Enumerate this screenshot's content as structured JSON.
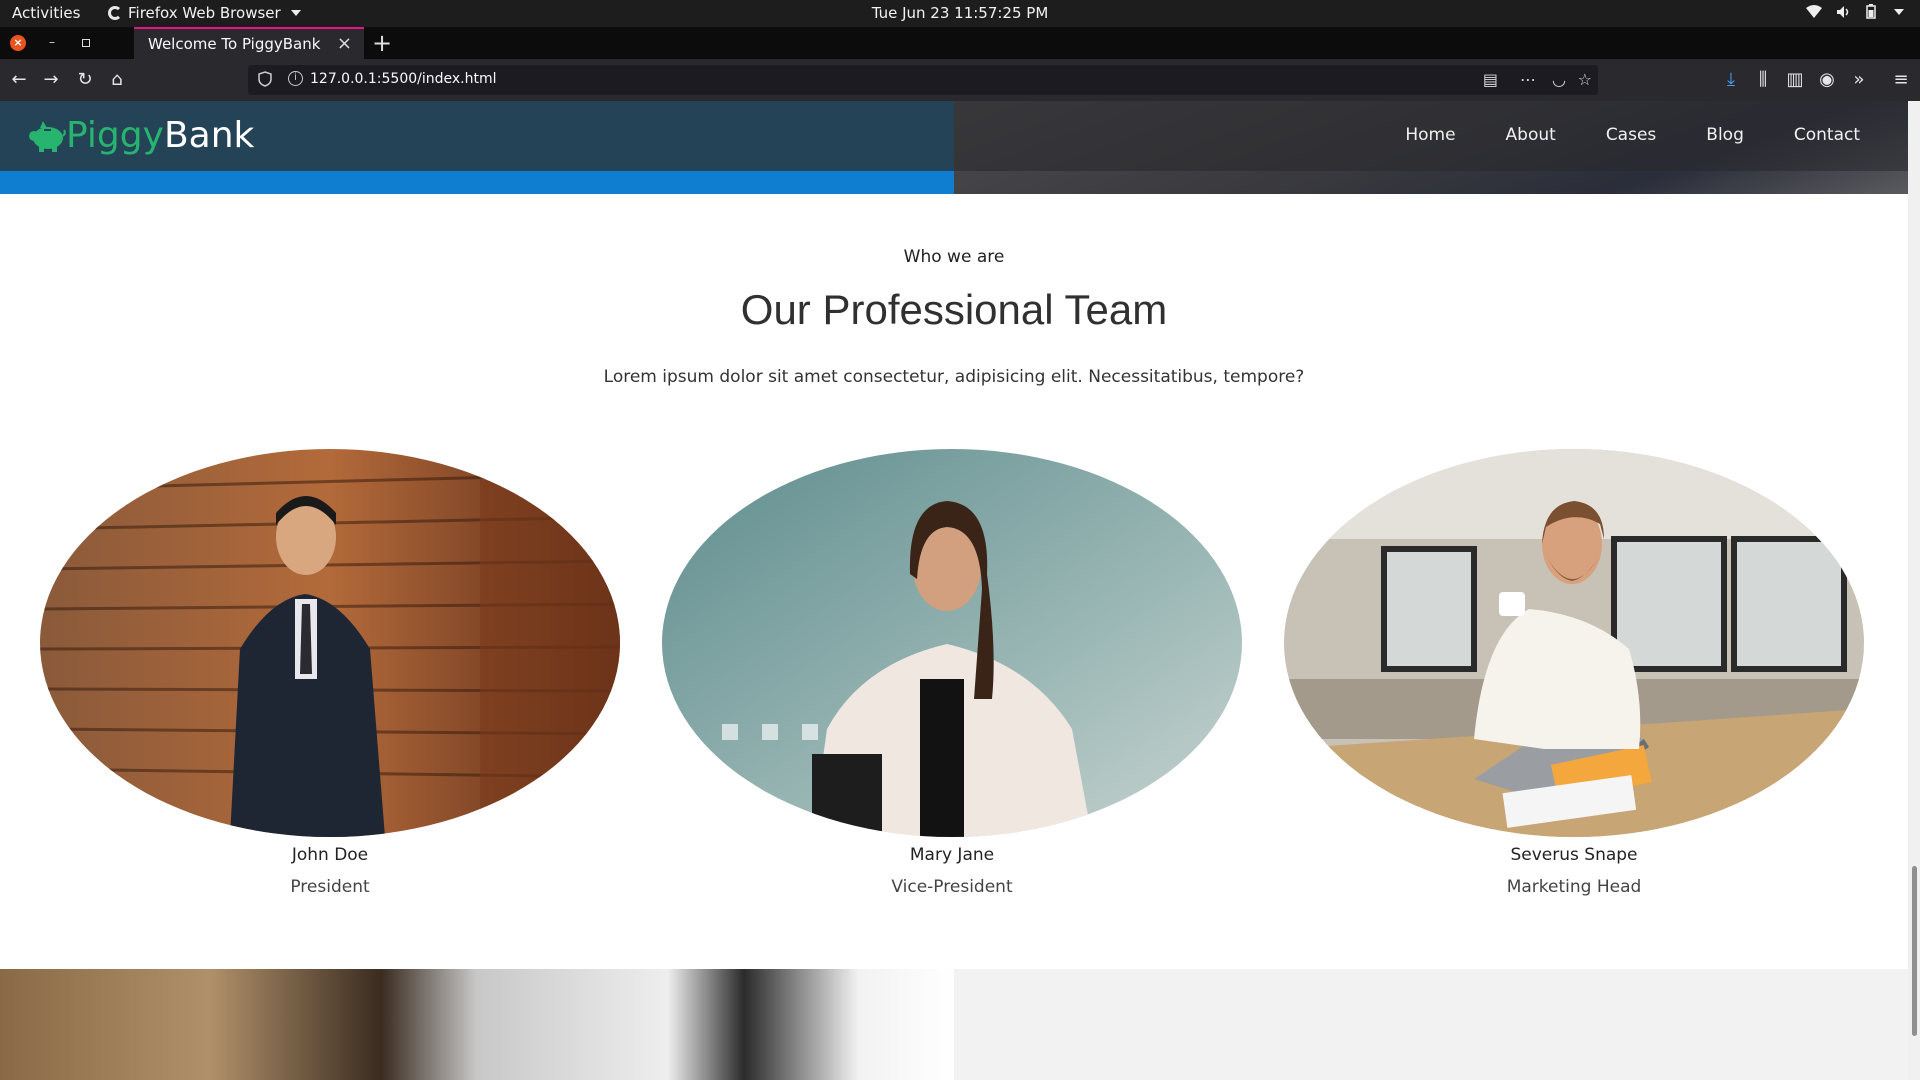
{
  "system_bar": {
    "activities": "Activities",
    "app_name": "Firefox Web Browser",
    "datetime": "Tue Jun 23  11:57:25 PM"
  },
  "browser": {
    "tab_title": "Welcome To PiggyBank",
    "url": "127.0.0.1:5500/index.html"
  },
  "site": {
    "logo_part1": "Piggy",
    "logo_part2": "Bank",
    "nav": [
      "Home",
      "About",
      "Cases",
      "Blog",
      "Contact"
    ]
  },
  "team_section": {
    "subtitle": "Who we are",
    "title": "Our Professional Team",
    "description": "Lorem ipsum dolor sit amet consectetur, adipisicing elit. Necessitatibus, tempore?",
    "members": [
      {
        "name": "John Doe",
        "role": "President"
      },
      {
        "name": "Mary Jane",
        "role": "Vice-President"
      },
      {
        "name": "Severus Snape",
        "role": "Marketing Head"
      }
    ]
  },
  "colors": {
    "header_dark": "#244356",
    "accent_blue": "#0f7ed0",
    "logo_green": "#27b46e"
  }
}
